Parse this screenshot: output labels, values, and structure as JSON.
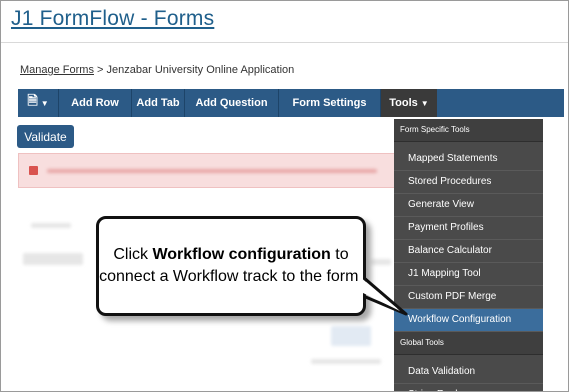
{
  "page": {
    "title": "J1 FormFlow - Forms"
  },
  "breadcrumb": {
    "link": "Manage Forms",
    "separator": ">",
    "current": "Jenzabar University Online Application"
  },
  "toolbar": {
    "document_icon": "document-icon",
    "add_row": "Add Row",
    "add_tab": "Add Tab",
    "add_question": "Add Question",
    "form_settings": "Form Settings",
    "tools": "Tools"
  },
  "validate_label": "Validate",
  "dropdown": {
    "section1": "Form Specific Tools",
    "items1": [
      "Mapped Statements",
      "Stored Procedures",
      "Generate View",
      "Payment Profiles",
      "Balance Calculator",
      "J1 Mapping Tool",
      "Custom PDF Merge",
      "Workflow Configuration"
    ],
    "section2": "Global Tools",
    "items2": [
      "Data Validation",
      "String Replacers"
    ],
    "active_item": "Workflow Configuration"
  },
  "callout": {
    "pre": "Click ",
    "bold": "Workflow configuration",
    "post": " to connect a Workflow track to the form."
  },
  "colors": {
    "toolbar": "#2c5a86",
    "dropdown": "#4a4a4a",
    "active": "#3b6d9c",
    "title": "#1f5f8b"
  }
}
